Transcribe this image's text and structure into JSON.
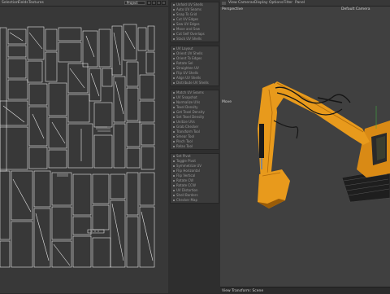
{
  "uv_editor": {
    "menu": [
      "Selection",
      "Fields",
      "Textures"
    ],
    "dropdown_value": "Project"
  },
  "tools": {
    "group1": [
      "Unfold UV Shells",
      "Auto UV Seams",
      "Snap To Grid",
      "Cut UV Edges",
      "Sew UV Edges",
      "Move and Sew",
      "Cut Self Overlaps",
      "Stack UV Shells"
    ],
    "group2": [
      "UV Layout",
      "Orient UV Shells",
      "Orient To Edges",
      "Rotate Sel",
      "Straighten UV",
      "Flip UV Shells",
      "Align UV Shells",
      "Distribute UV Shells"
    ],
    "group3": [
      "Match UV Seams",
      "UV Snapshot",
      "Normalize UVs",
      "Texel Density",
      "Get Texel Density",
      "Set Texel Density",
      "Unitize UVs",
      "Grab Checker",
      "Transform Tool",
      "Smear Tool",
      "Pinch Tool",
      "Relax Tool"
    ],
    "group4": [
      "Set Pivot",
      "Toggle Pivot",
      "Symmetrize UV",
      "Flip Horizontal",
      "Flip Vertical",
      "Rotate CW",
      "Rotate CCW",
      "UV Distortion",
      "Shell Borders",
      "Checker Map"
    ]
  },
  "viewport": {
    "menu": [
      "View",
      "Cameras",
      "Display",
      "Options",
      "Filter",
      "Panel"
    ],
    "camera_name": "Perspective",
    "camera_label": "Default Camera",
    "move_label": "Move",
    "status": "View Transform: Scene"
  },
  "colors": {
    "mesh_body": "#e89a1c",
    "mesh_dark": "#1c1c1c",
    "uv_lines": "#e8e8e8"
  }
}
